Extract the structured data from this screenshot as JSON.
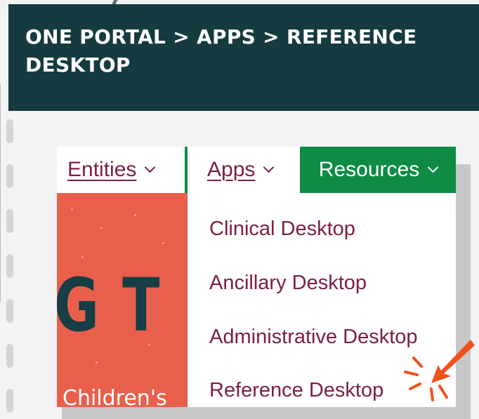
{
  "header": {
    "title": "ONE PORTAL > APPS > REFERENCE DESKTOP"
  },
  "nav": {
    "entities_label": "Entities",
    "apps_label": "Apps",
    "resources_label": "Resources"
  },
  "dropdown": {
    "items": [
      {
        "label": "Clinical Desktop"
      },
      {
        "label": "Ancillary Desktop"
      },
      {
        "label": "Administrative Desktop"
      },
      {
        "label": "Reference Desktop"
      }
    ]
  },
  "hero": {
    "headline": "G T",
    "subline": "Children's"
  },
  "colors": {
    "header_bg": "#153a40",
    "nav_green": "#0f8b45",
    "link_maroon": "#7b1e46",
    "hero_coral": "#e8604c",
    "highlight_orange": "#f0521e"
  }
}
